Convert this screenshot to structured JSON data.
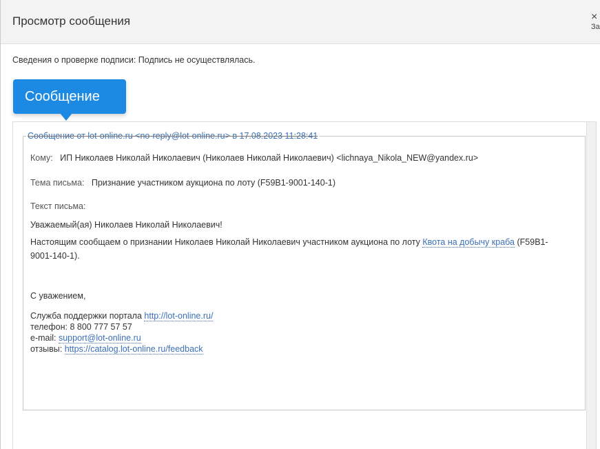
{
  "window": {
    "title": "Просмотр сообщения",
    "close_glyph": "×",
    "close_label": "Закрыть"
  },
  "signature_info": "Сведения о проверке подписи: Подпись не осуществлялась.",
  "tab": {
    "label": "Сообщение",
    "color": "#1c8ae3"
  },
  "message": {
    "legend": "Сообщение от lot-online.ru <no-reply@lot-online.ru> в 17.08.2023 11:28:41",
    "to_label": "Кому:",
    "to_value": "ИП Николаев Николай Николаевич (Николаев Николай Николаевич) <lichnaya_Nikola_NEW@yandex.ru>",
    "subject_label": "Тема письма:",
    "subject_value": "Признание участником аукциона по лоту (F59B1-9001-140-1)",
    "body_label": "Текст письма:",
    "greeting": "Уважаемый(ая) Николаев Николай Николаевич!",
    "body_text_before": "Настоящим сообщаем о признании Николаев Николай Николаевич участником аукциона по лоту ",
    "lot_link": "Квота на добычу краба",
    "body_text_after": " (F59B1-9001-140-1).",
    "regards": "С уважением,",
    "support_label": "Служба поддержки портала ",
    "support_link": "http://lot-online.ru/",
    "phone_line": "телефон: 8 800 777 57 57",
    "email_label": "e-mail: ",
    "email_link": "support@lot-online.ru",
    "feedback_label": "отзывы: ",
    "feedback_link": "https://catalog.lot-online.ru/feedback"
  }
}
